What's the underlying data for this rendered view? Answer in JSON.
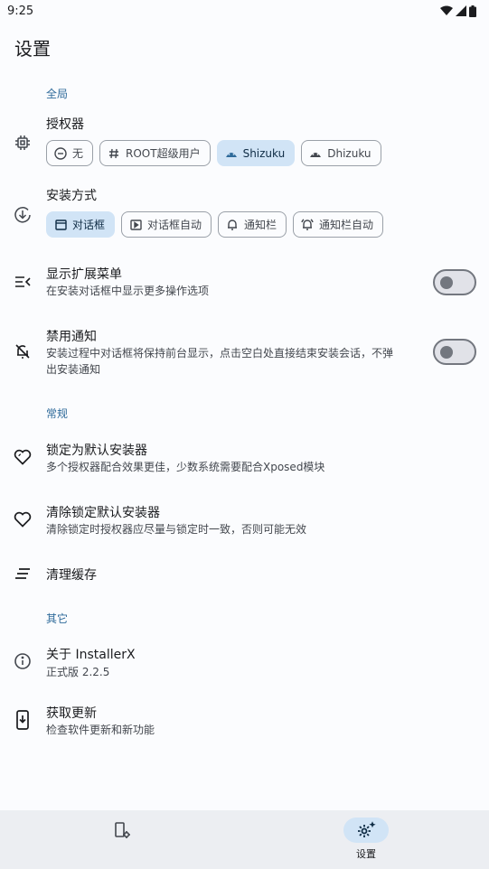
{
  "status": {
    "time": "9:25"
  },
  "page_title": "设置",
  "sections": {
    "global": "全局",
    "general": "常规",
    "other": "其它"
  },
  "authorizer": {
    "title": "授权器",
    "options": [
      "无",
      "ROOT超级用户",
      "Shizuku",
      "Dhizuku"
    ],
    "selected": "Shizuku"
  },
  "install_method": {
    "title": "安装方式",
    "options": [
      "对话框",
      "对话框自动",
      "通知栏",
      "通知栏自动"
    ],
    "selected": "对话框"
  },
  "extended_menu": {
    "title": "显示扩展菜单",
    "subtitle": "在安装对话框中显示更多操作选项",
    "enabled": false
  },
  "disable_notification": {
    "title": "禁用通知",
    "subtitle_line1": "安装过程中对话框将保持前台显示，点击空白处直接结束安装会话，不弹",
    "subtitle_line2": "出安装通知",
    "enabled": false
  },
  "lock_default": {
    "title": "锁定为默认安装器",
    "subtitle": "多个授权器配合效果更佳，少数系统需要配合Xposed模块"
  },
  "clear_lock": {
    "title": "清除锁定默认安装器",
    "subtitle": "清除锁定时授权器应尽量与锁定时一致，否则可能无效"
  },
  "clear_cache": {
    "title": "清理缓存"
  },
  "about": {
    "title": "关于 InstallerX",
    "subtitle": "正式版 2.2.5"
  },
  "update": {
    "title": "获取更新",
    "subtitle": "检查软件更新和新功能"
  },
  "bottom_nav": {
    "settings_label": "设置",
    "active": "settings"
  },
  "colors": {
    "accent": "#2e6a9a",
    "chip_selected": "#d1e4f6"
  }
}
